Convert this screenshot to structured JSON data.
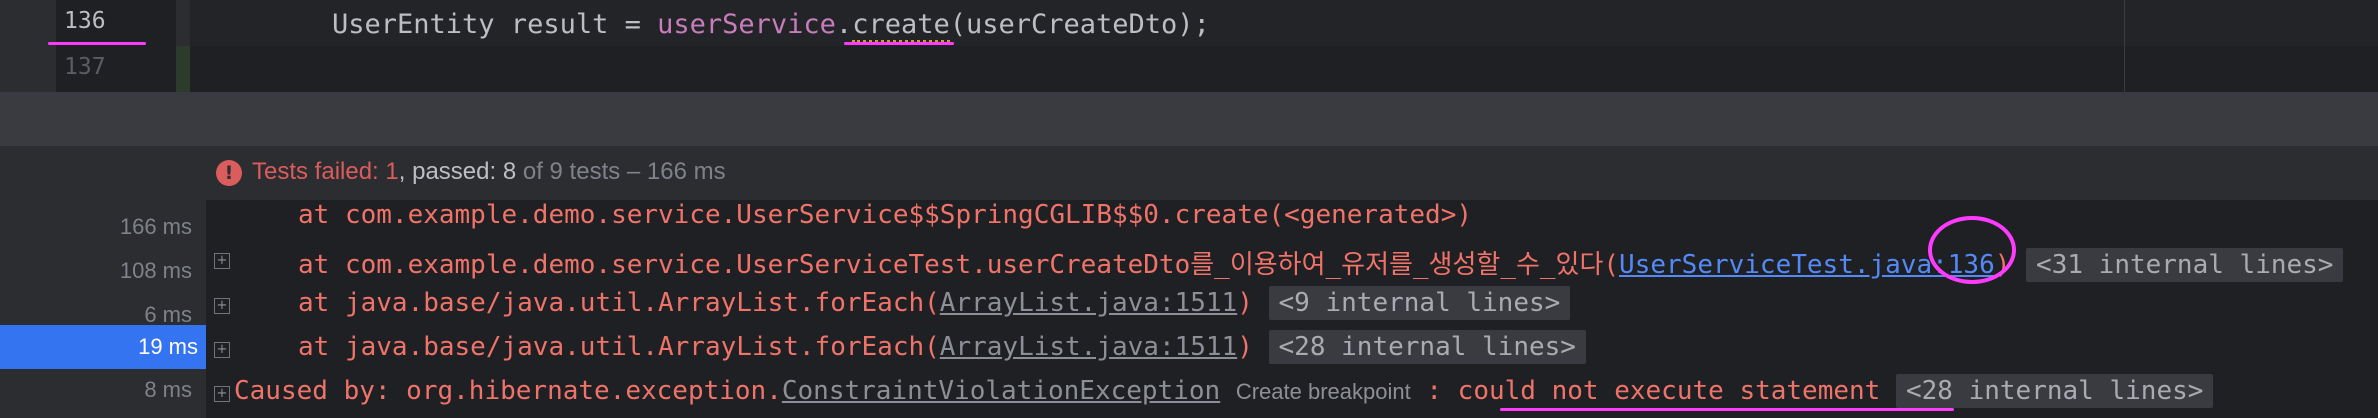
{
  "editor": {
    "lines": [
      {
        "number": "136",
        "code_prefix": "UserEntity result = ",
        "code_service": "userService",
        "code_dot": ".",
        "code_method": "create",
        "code_suffix": "(userCreateDto);"
      },
      {
        "number": "137"
      }
    ]
  },
  "test_status": {
    "failed_label": "Tests failed: ",
    "failed_count": "1",
    "passed_label": ", passed: ",
    "passed_count": "8",
    "total_text": " of 9 tests – 166 ms",
    "icon": "error-circle-icon"
  },
  "timings": [
    "166 ms",
    "108 ms",
    "6 ms",
    "19 ms",
    "8 ms"
  ],
  "console": {
    "line1": "at com.example.demo.service.UserService$$SpringCGLIB$$0.create(<generated>)",
    "line2_prefix": "at com.example.demo.service.UserServiceTest.userCreateDto를_이용하여_유저를_생성할_수_있다(",
    "line2_link": "UserServiceTest.java:136",
    "line2_suffix": ")",
    "line2_folded": "<31 internal lines>",
    "line3_prefix": "at java.base/java.util.ArrayList.forEach(",
    "line3_link": "ArrayList.java:1511",
    "line3_suffix": ")",
    "line3_folded": "<9 internal lines>",
    "line4_prefix": "at java.base/java.util.ArrayList.forEach(",
    "line4_link": "ArrayList.java:1511",
    "line4_suffix": ")",
    "line4_folded": "<28 internal lines>",
    "line5_prefix": "Caused by: org.hibernate.exception.",
    "line5_link": "ConstraintViolationException",
    "line5_breakpoint": "Create breakpoint",
    "line5_message": " : could not execute statement",
    "line5_folded": "<28 internal lines>"
  },
  "colors": {
    "annotation": "#ff3bff",
    "error": "#f0736a",
    "link": "#548af7",
    "selection": "#3574f0"
  }
}
